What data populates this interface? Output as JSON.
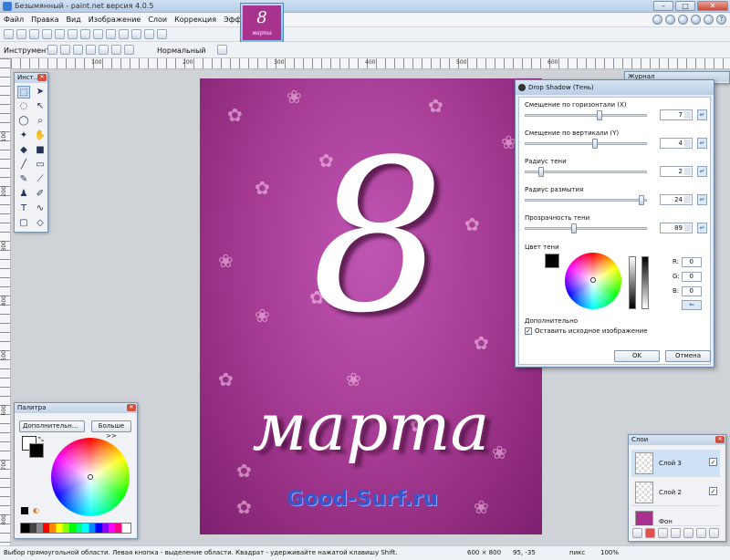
{
  "window": {
    "title": "Безымянный - paint.net версия 4.0.5"
  },
  "menu": [
    "Файл",
    "Правка",
    "Вид",
    "Изображение",
    "Слои",
    "Коррекция",
    "Эффекты"
  ],
  "thumbnail": {
    "big": "8",
    "small": "марта"
  },
  "toolbar": {
    "tool_label": "Инструмент:",
    "blend_mode": "Нормальный"
  },
  "ruler": {
    "h": [
      "100",
      "200",
      "300",
      "400",
      "500",
      "600"
    ],
    "v": [
      "100",
      "200",
      "300",
      "400",
      "500",
      "600",
      "700",
      "800"
    ]
  },
  "canvas": {
    "number": "8",
    "word": "марта",
    "watermark": "Good-Surf.ru"
  },
  "tools_panel": {
    "title": "Инст..."
  },
  "history_panel": {
    "title": "Журнал"
  },
  "palette_panel": {
    "title": "Палитра",
    "mode": "Дополнительн...",
    "more": "Больше >>"
  },
  "layers_panel": {
    "title": "Слои",
    "layers": [
      {
        "name": "Слой 3",
        "visible": "✓"
      },
      {
        "name": "Слой 2",
        "visible": "✓"
      },
      {
        "name": "Фон",
        "visible": ""
      }
    ]
  },
  "dialog": {
    "title": "Drop Shadow (Тень)",
    "params": [
      {
        "label": "Смещение по горизонтали (X)",
        "value": "7",
        "level": 0.62
      },
      {
        "label": "Смещение по вертикали (Y)",
        "value": "4",
        "level": 0.58
      },
      {
        "label": "Радиус тени",
        "value": "2",
        "level": 0.12
      },
      {
        "label": "Радиус размытия",
        "value": "24",
        "level": 0.98
      },
      {
        "label": "Прозрачность тени",
        "value": "89",
        "level": 0.4
      }
    ],
    "color_label": "Цвет тени",
    "rgb": [
      {
        "k": "R:",
        "v": "0"
      },
      {
        "k": "G:",
        "v": "0"
      },
      {
        "k": "B:",
        "v": "0"
      }
    ],
    "extra_label": "Дополнительно",
    "keep_label": "Оставить исходное изображение",
    "ok": "OK",
    "cancel": "Отмена"
  },
  "status": {
    "hint": "Выбор прямоугольной области. Левая кнопка - выделение области. Квадрат - удерживайте нажатой клавишу Shift.",
    "size": "600 × 800",
    "coords": "95, -35",
    "units": "пикс",
    "zoom": "100%"
  }
}
